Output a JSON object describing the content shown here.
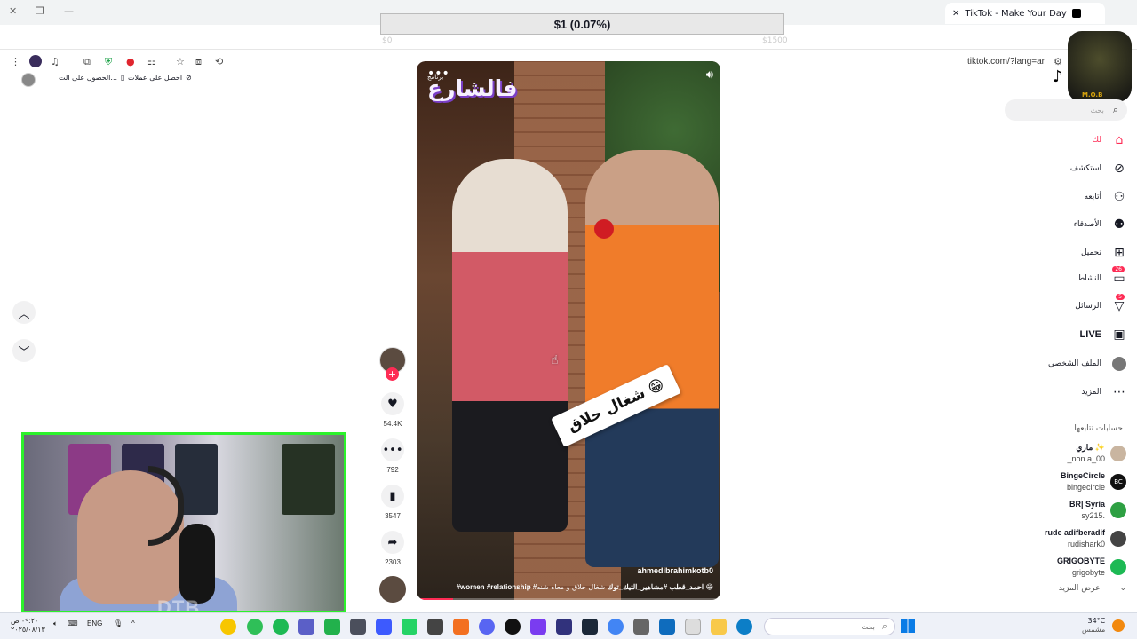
{
  "browser": {
    "tab_title": "TikTok - Make Your Day",
    "url": "tiktok.com/?lang=ar"
  },
  "donation_overlay": {
    "amount": "$1 (0.07%)",
    "min_label": "$0",
    "max_label": "$1500"
  },
  "promo": {
    "coins_label": "احصل على عملات",
    "get_label": "الحصول على الت..."
  },
  "video": {
    "brand_small": "برنامج",
    "brand": "فالشارع",
    "sticker": "شغال حلاق 😁",
    "author": "ahmedibrahimkotb0",
    "caption": "شغال حلاق و معاه شنه 😁",
    "hashtags": "#women #relationship #احمد_قطب #مشاهير_التيك_توك",
    "progress": 0.12
  },
  "actions": {
    "likes": "54.4K",
    "comments": "792",
    "saves": "3547",
    "shares": "2303"
  },
  "sidebar": {
    "search_placeholder": "بحث",
    "skull_text": "M.O.B",
    "nav": [
      {
        "label": "لك",
        "icon": "home-icon"
      },
      {
        "label": "استكشف",
        "icon": "compass-icon"
      },
      {
        "label": "أتابعه",
        "icon": "user-follow-icon"
      },
      {
        "label": "الأصدقاء",
        "icon": "friends-icon"
      },
      {
        "label": "تحميل",
        "icon": "upload-icon"
      },
      {
        "label": "النشاط",
        "icon": "inbox-icon",
        "badge": "26"
      },
      {
        "label": "الرسائل",
        "icon": "send-icon",
        "badge": "5"
      },
      {
        "label": "LIVE",
        "icon": "live-icon"
      },
      {
        "label": "الملف الشخصي",
        "icon": "profile-icon"
      },
      {
        "label": "المزيد",
        "icon": "more-icon"
      }
    ],
    "following_title": "حسابات تتابعها",
    "accounts": [
      {
        "name": "ماري ✨",
        "user": "_non.a_00",
        "color": "#c9b5a0"
      },
      {
        "name": "BingeCircle",
        "user": "bingecircle",
        "color": "#111",
        "initials": "BC"
      },
      {
        "name": "BR| Syria",
        "user": "sy215.",
        "color": "#2ea043"
      },
      {
        "name": "rude adifberadif",
        "user": "rudishark0",
        "color": "#444"
      },
      {
        "name": "GRIGOBYTE",
        "user": "grigobyte",
        "color": "#1db954"
      }
    ],
    "see_more": "عرض المزيد"
  },
  "taskbar": {
    "time": "٠٩:٢٠ ص",
    "date": "٢٠٢٥/٠٨/١٣",
    "lang": "ENG",
    "search_placeholder": "بحث",
    "temp": "34°C",
    "weather": "مشمس"
  },
  "webcam": {
    "watermark": "DTB",
    "border_color": "#2cf22b"
  },
  "colors": {
    "accent": "#fe2c55"
  }
}
